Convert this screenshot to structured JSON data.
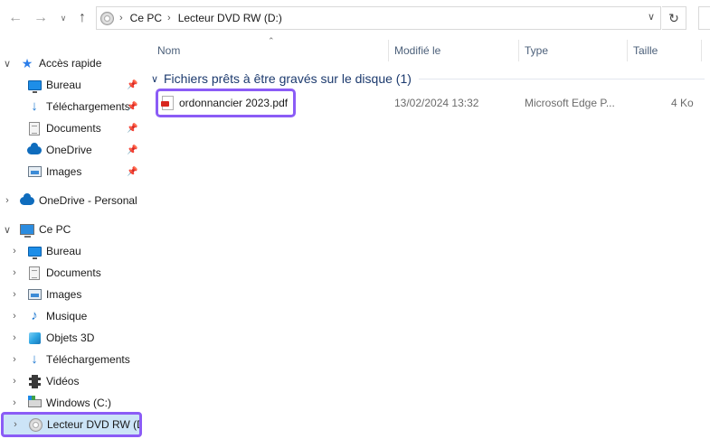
{
  "address": {
    "crumbs": [
      "Ce PC",
      "Lecteur DVD RW (D:)"
    ]
  },
  "sidebar": {
    "quick_access": {
      "label": "Accès rapide",
      "items": [
        {
          "label": "Bureau",
          "icon": "desktop-icon",
          "pinned": true
        },
        {
          "label": "Téléchargements",
          "icon": "download-icon",
          "pinned": true
        },
        {
          "label": "Documents",
          "icon": "documents-icon",
          "pinned": true
        },
        {
          "label": "OneDrive",
          "icon": "onedrive-icon",
          "pinned": true
        },
        {
          "label": "Images",
          "icon": "images-icon",
          "pinned": true
        }
      ]
    },
    "onedrive_personal": {
      "label": "OneDrive - Personal",
      "icon": "onedrive-icon"
    },
    "this_pc": {
      "label": "Ce PC",
      "items": [
        {
          "label": "Bureau",
          "icon": "desktop-icon"
        },
        {
          "label": "Documents",
          "icon": "documents-icon"
        },
        {
          "label": "Images",
          "icon": "images-icon"
        },
        {
          "label": "Musique",
          "icon": "music-icon"
        },
        {
          "label": "Objets 3D",
          "icon": "3d-objects-icon"
        },
        {
          "label": "Téléchargements",
          "icon": "download-icon"
        },
        {
          "label": "Vidéos",
          "icon": "videos-icon"
        },
        {
          "label": "Windows (C:)",
          "icon": "drive-icon"
        },
        {
          "label": "Lecteur DVD RW (D:)",
          "icon": "dvd-drive-icon",
          "selected": true
        }
      ]
    }
  },
  "columns": {
    "name": "Nom",
    "modified": "Modifié le",
    "type": "Type",
    "size": "Taille"
  },
  "group": {
    "title": "Fichiers prêts à être gravés sur le disque (1)"
  },
  "files": [
    {
      "name": "ordonnancier 2023.pdf",
      "modified": "13/02/2024 13:32",
      "type": "Microsoft Edge P...",
      "size": "4 Ko"
    }
  ],
  "colors": {
    "highlight": "#8b5cf6",
    "selection": "#cce4f7",
    "group_title": "#1c3a6e"
  }
}
